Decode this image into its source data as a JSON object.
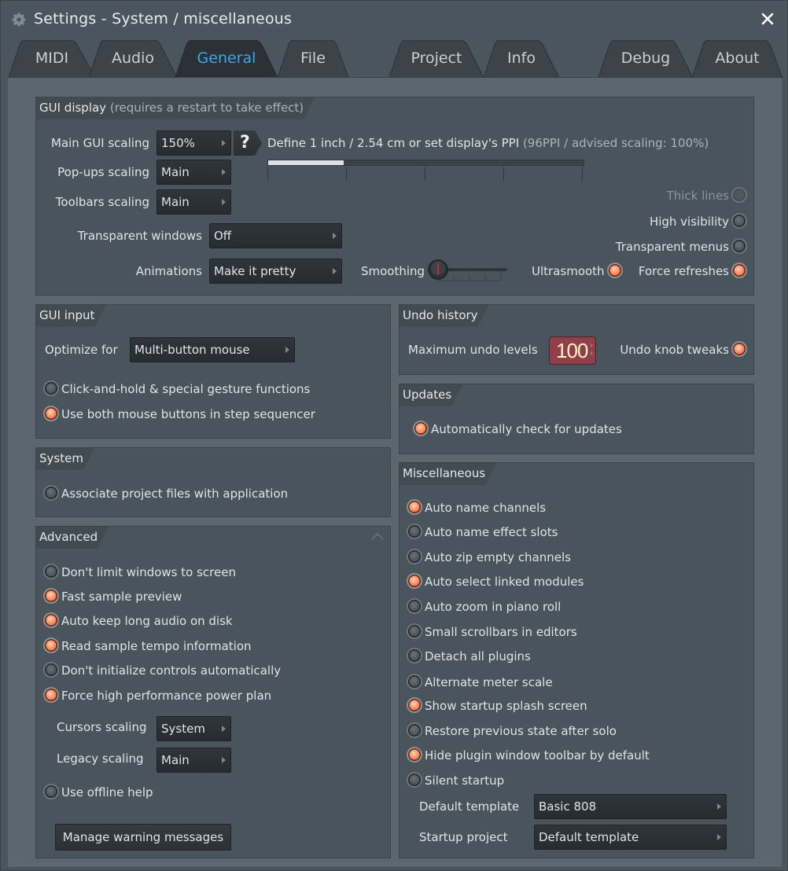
{
  "window": {
    "title": "Settings - System / miscellaneous",
    "icon": "gear-icon",
    "close_icon": "close-icon"
  },
  "tabs": [
    {
      "label": "MIDI",
      "active": false
    },
    {
      "label": "Audio",
      "active": false
    },
    {
      "label": "General",
      "active": true
    },
    {
      "label": "File",
      "active": false
    },
    {
      "label": "Project",
      "active": false
    },
    {
      "label": "Info",
      "active": false
    },
    {
      "label": "Debug",
      "active": false
    },
    {
      "label": "About",
      "active": false
    }
  ],
  "gui_display": {
    "title": "GUI display",
    "subtitle": "(requires a restart to take effect)",
    "main_scaling_label": "Main GUI scaling",
    "main_scaling_value": "150%",
    "popups_scaling_label": "Pop-ups scaling",
    "popups_scaling_value": "Main",
    "toolbars_scaling_label": "Toolbars scaling",
    "toolbars_scaling_value": "Main",
    "help_label": "?",
    "ppi_text": "Define 1 inch / 2.54 cm or set display's PPI",
    "ppi_info": "(96PPI / advised scaling: 100%)",
    "ppi_fill_fraction": 0.24,
    "transparent_windows_label": "Transparent windows",
    "transparent_windows_value": "Off",
    "animations_label": "Animations",
    "animations_value": "Make it pretty",
    "smoothing_label": "Smoothing",
    "smoothing_value": 0,
    "thick_lines": {
      "label": "Thick lines",
      "checked": false,
      "disabled": true
    },
    "high_visibility": {
      "label": "High visibility",
      "checked": false
    },
    "transparent_menus": {
      "label": "Transparent menus",
      "checked": false
    },
    "ultrasmooth": {
      "label": "Ultrasmooth",
      "checked": true
    },
    "force_refreshes": {
      "label": "Force refreshes",
      "checked": true
    }
  },
  "gui_input": {
    "title": "GUI input",
    "optimize_label": "Optimize for",
    "optimize_value": "Multi-button mouse",
    "options": [
      {
        "label": "Click-and-hold & special gesture functions",
        "checked": false
      },
      {
        "label": "Use both mouse buttons in step sequencer",
        "checked": true
      }
    ]
  },
  "system": {
    "title": "System",
    "options": [
      {
        "label": "Associate project files with application",
        "checked": false
      }
    ]
  },
  "advanced": {
    "title": "Advanced",
    "options": [
      {
        "label": "Don't limit windows to screen",
        "checked": false
      },
      {
        "label": "Fast sample preview",
        "checked": true
      },
      {
        "label": "Auto keep long audio on disk",
        "checked": true
      },
      {
        "label": "Read sample tempo information",
        "checked": true
      },
      {
        "label": "Don't initialize controls automatically",
        "checked": false
      },
      {
        "label": "Force high performance power plan",
        "checked": true
      }
    ],
    "cursors_scaling_label": "Cursors scaling",
    "cursors_scaling_value": "System",
    "legacy_scaling_label": "Legacy scaling",
    "legacy_scaling_value": "Main",
    "offline_help": {
      "label": "Use offline help",
      "checked": false
    },
    "manage_warnings_label": "Manage warning messages"
  },
  "undo_history": {
    "title": "Undo history",
    "max_levels_label": "Maximum undo levels",
    "max_levels_value": "100",
    "knob_tweaks": {
      "label": "Undo knob tweaks",
      "checked": true
    }
  },
  "updates": {
    "title": "Updates",
    "options": [
      {
        "label": "Automatically check for updates",
        "checked": true
      }
    ]
  },
  "miscellaneous": {
    "title": "Miscellaneous",
    "options": [
      {
        "label": "Auto name channels",
        "checked": true
      },
      {
        "label": "Auto name effect slots",
        "checked": false
      },
      {
        "label": "Auto zip empty channels",
        "checked": false
      },
      {
        "label": "Auto select linked modules",
        "checked": true
      },
      {
        "label": "Auto zoom in piano roll",
        "checked": false
      },
      {
        "label": "Small scrollbars in editors",
        "checked": false
      },
      {
        "label": "Detach all plugins",
        "checked": false
      },
      {
        "label": "Alternate meter scale",
        "checked": false
      },
      {
        "label": "Show startup splash screen",
        "checked": true
      },
      {
        "label": "Restore previous state after solo",
        "checked": false
      },
      {
        "label": "Hide plugin window toolbar by default",
        "checked": true
      },
      {
        "label": "Silent startup",
        "checked": false
      }
    ],
    "default_template_label": "Default template",
    "default_template_value": "Basic 808",
    "startup_project_label": "Startup project",
    "startup_project_value": "Default template"
  }
}
